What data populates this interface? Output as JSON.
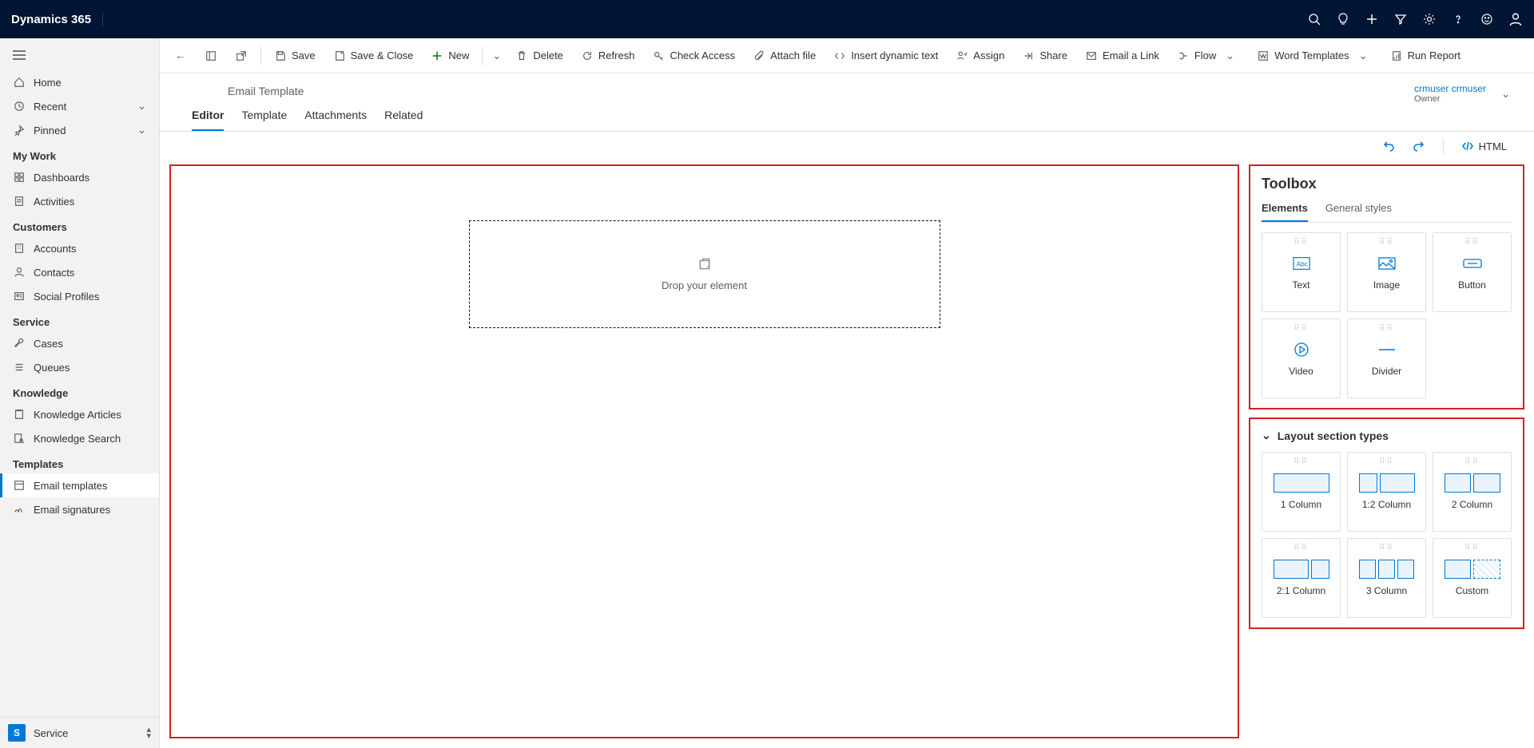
{
  "brand": "Dynamics 365",
  "sidebar": {
    "home": "Home",
    "recent": "Recent",
    "pinned": "Pinned",
    "sections": {
      "mywork": "My Work",
      "customers": "Customers",
      "service": "Service",
      "knowledge": "Knowledge",
      "templates": "Templates"
    },
    "items": {
      "dashboards": "Dashboards",
      "activities": "Activities",
      "accounts": "Accounts",
      "contacts": "Contacts",
      "socialprofiles": "Social Profiles",
      "cases": "Cases",
      "queues": "Queues",
      "karticles": "Knowledge Articles",
      "ksearch": "Knowledge Search",
      "emailtemplates": "Email templates",
      "emailsignatures": "Email signatures"
    },
    "app": {
      "badge": "S",
      "name": "Service"
    }
  },
  "cmd": {
    "save": "Save",
    "saveclose": "Save & Close",
    "new": "New",
    "delete": "Delete",
    "refresh": "Refresh",
    "checkaccess": "Check Access",
    "attach": "Attach file",
    "insertdyn": "Insert dynamic text",
    "assign": "Assign",
    "share": "Share",
    "emaillink": "Email a Link",
    "flow": "Flow",
    "wordtemplates": "Word Templates",
    "runreport": "Run Report"
  },
  "record": {
    "title": "Email Template",
    "tabs": {
      "editor": "Editor",
      "template": "Template",
      "attachments": "Attachments",
      "related": "Related"
    },
    "owner": {
      "name": "crmuser crmuser",
      "label": "Owner"
    }
  },
  "subbar": {
    "html": "HTML"
  },
  "canvas": {
    "drop": "Drop your element"
  },
  "toolbox": {
    "title": "Toolbox",
    "tabs": {
      "elements": "Elements",
      "styles": "General styles"
    },
    "tiles": {
      "text": "Text",
      "image": "Image",
      "button": "Button",
      "video": "Video",
      "divider": "Divider"
    },
    "layout": {
      "head": "Layout section types",
      "c1": "1 Column",
      "c12": "1:2 Column",
      "c2": "2 Column",
      "c21": "2:1 Column",
      "c3": "3 Column",
      "custom": "Custom"
    }
  }
}
